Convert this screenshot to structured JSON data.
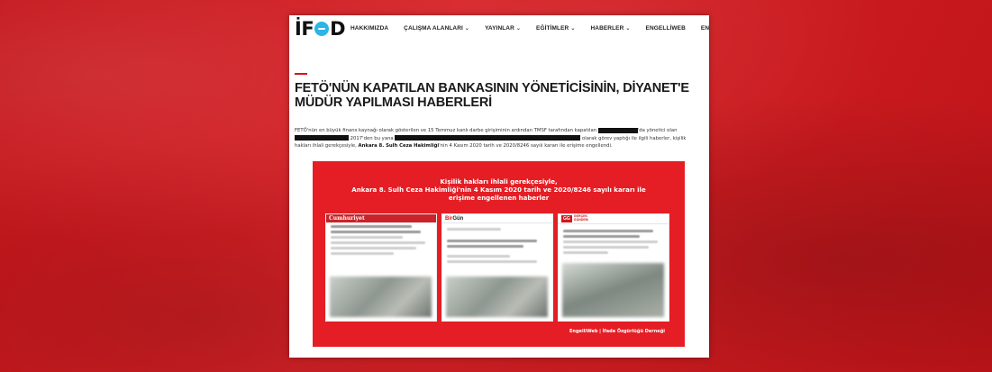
{
  "site": {
    "logo_left": "İF",
    "logo_right": "D",
    "nav": [
      {
        "label": "HAKKIMIZDA",
        "dropdown": false
      },
      {
        "label": "ÇALIŞMA ALANLARI",
        "dropdown": true
      },
      {
        "label": "YAYINLAR",
        "dropdown": true
      },
      {
        "label": "EĞİTİMLER",
        "dropdown": true
      },
      {
        "label": "HABERLER",
        "dropdown": true
      },
      {
        "label": "ENGELLİWEB",
        "dropdown": false
      },
      {
        "label": "ENGLISH",
        "dropdown": false
      }
    ]
  },
  "article": {
    "title": "FETÖ'NÜN KAPATILAN BANKASININ YÖNETİCİSİNİN, DİYANET'E MÜDÜR YAPILMASI HABERLERİ",
    "p1": "FETÖ'nün en büyük finans kaynağı olarak gösterilen ve 15 Temmuz kanlı darbe girişiminin ardından TMSF tarafından kapatılan ",
    "p2": "'da yönetici olan ",
    "p3": " 2017'den bu yana ",
    "p4": " olarak görev yaptığı ile ilgili haberler, kişilik hakları ihlali gerekçesiyle, ",
    "p_bold": "Ankara 8. Sulh Ceza Hakimliği",
    "p5": "'nin 4 Kasım 2020 tarih ve 2020/8246 sayılı kararı ile erişime engellendi."
  },
  "banner": {
    "line1": "Kişilik hakları ihlali gerekçesiyle,",
    "line2": "Ankara 8. Sulh Ceza Hakimliği'nin 4 Kasım 2020 tarih ve 2020/8246 sayılı kararı ile",
    "line3": "erişime engellenen haberler",
    "card1_brand": "Cumhuriyet",
    "card2_brand_a": "Bir",
    "card2_brand_b": "Gün",
    "card3_badge": "GG",
    "card3_text_a": "GERÇEK",
    "card3_text_b": "GÜNDEM",
    "footer": "EngelliWeb | İfade Özgürlüğü Derneği"
  },
  "colors": {
    "background": "#d4161b",
    "banner": "#e41e24",
    "logo_accent": "#2bb6e6"
  }
}
